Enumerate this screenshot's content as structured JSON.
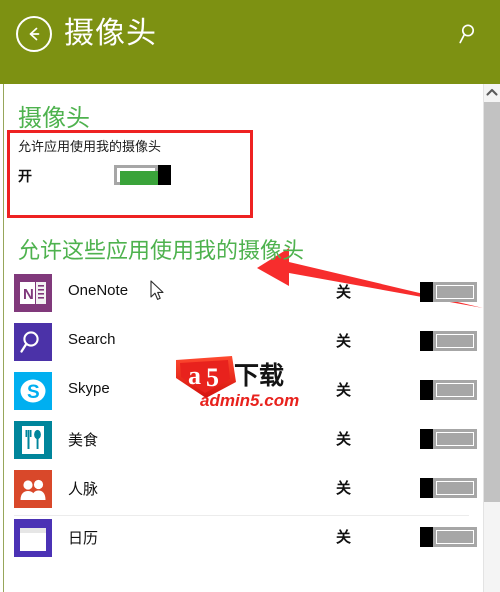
{
  "header": {
    "title": "摄像头",
    "back_icon": "arrow-left-circle-icon",
    "search_icon": "search-icon",
    "background_color": "#7d9112"
  },
  "main": {
    "section_camera_title": "摄像头",
    "master": {
      "label": "允许应用使用我的摄像头",
      "state_text": "开",
      "toggle_state": "on",
      "toggle_on_color": "#3aa33a"
    },
    "section_apps_title": "允许这些应用使用我的摄像头",
    "apps": [
      {
        "name": "OneNote",
        "state": "关",
        "toggle_state": "off",
        "icon": "onenote-icon",
        "icon_color": "#80397b"
      },
      {
        "name": "Search",
        "state": "关",
        "toggle_state": "off",
        "icon": "search-app-icon",
        "icon_color": "#4b32a8"
      },
      {
        "name": "Skype",
        "state": "关",
        "toggle_state": "off",
        "icon": "skype-icon",
        "icon_color": "#00aff0"
      },
      {
        "name": "美食",
        "state": "关",
        "toggle_state": "off",
        "icon": "food-fork-spoon-icon",
        "icon_color": "#00859b"
      },
      {
        "name": "人脉",
        "state": "关",
        "toggle_state": "off",
        "icon": "people-icon",
        "icon_color": "#d9482a"
      },
      {
        "name": "日历",
        "state": "关",
        "toggle_state": "off",
        "icon": "calendar-icon",
        "icon_color": "#4b32b5"
      }
    ]
  },
  "annotations": {
    "highlight_box_color": "#ee2222",
    "arrow_color": "#f72d2d",
    "cursor_icon": "mouse-pointer-icon"
  },
  "watermark": {
    "logo_text": "a5下载",
    "url_text": "admin5.com",
    "color": "#e8221d"
  },
  "scrollbar": {
    "up_arrow_icon": "chevron-up-icon",
    "thumb_color": "#c2c2c2"
  }
}
